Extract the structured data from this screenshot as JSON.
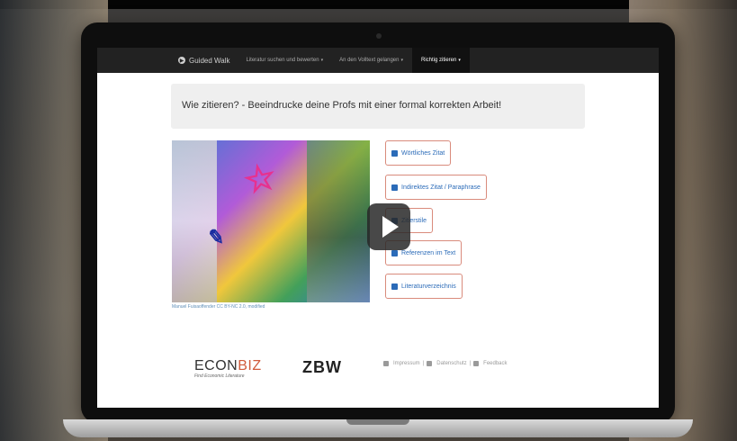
{
  "nav": {
    "brand": "Guided Walk",
    "items": [
      {
        "label": "Literatur suchen und bewerten",
        "caret": "▾"
      },
      {
        "label": "An den Volltext gelangen",
        "caret": "▾"
      },
      {
        "label": "Richtig zitieren",
        "caret": "▾"
      }
    ]
  },
  "jumbotron": {
    "heading": "Wie zitieren? - Beeindrucke deine Profs mit einer formal korrekten Arbeit!"
  },
  "image": {
    "credit": "Manuel Fuisaoffender CC BY-NC 2.0, modified"
  },
  "buttons": [
    {
      "label": "Wörtliches Zitat"
    },
    {
      "label": "Indirektes Zitat / Paraphrase"
    },
    {
      "label": "Zitierstile"
    },
    {
      "label": "Referenzen im Text"
    },
    {
      "label": "Literaturverzeichnis"
    }
  ],
  "logos": {
    "econbiz_prefix": "ECON",
    "econbiz_suffix": "BIZ",
    "econbiz_tagline": "Find Economic Literature",
    "zbw": "ZBW"
  },
  "footer": {
    "impressum": "Impressum",
    "datenschutz": "Datenschutz",
    "feedback": "Feedback",
    "sep": "|"
  },
  "colors": {
    "accent": "#2b6bb8",
    "button_border": "#d98b7c",
    "nav_bg": "#222222"
  },
  "icons": {
    "play": "play-icon",
    "brand": "circle-arrow-icon",
    "button": "square-icon"
  }
}
